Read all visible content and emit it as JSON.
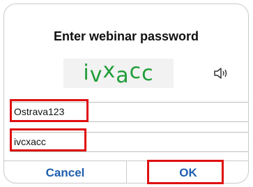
{
  "dialog": {
    "title": "Enter webinar password",
    "captcha": {
      "text": "ivxacc",
      "chars": [
        "i",
        "v",
        "x",
        "a",
        "c",
        "c"
      ],
      "color": "#1f9d38"
    },
    "speaker_icon": "speaker-icon",
    "fields": [
      {
        "value": "Ostrava123",
        "placeholder": ""
      },
      {
        "value": "ivcxacc",
        "placeholder": ""
      }
    ],
    "buttons": {
      "cancel_label": "Cancel",
      "ok_label": "OK",
      "color": "#1f5fae"
    },
    "highlight_color": "#e01010"
  }
}
